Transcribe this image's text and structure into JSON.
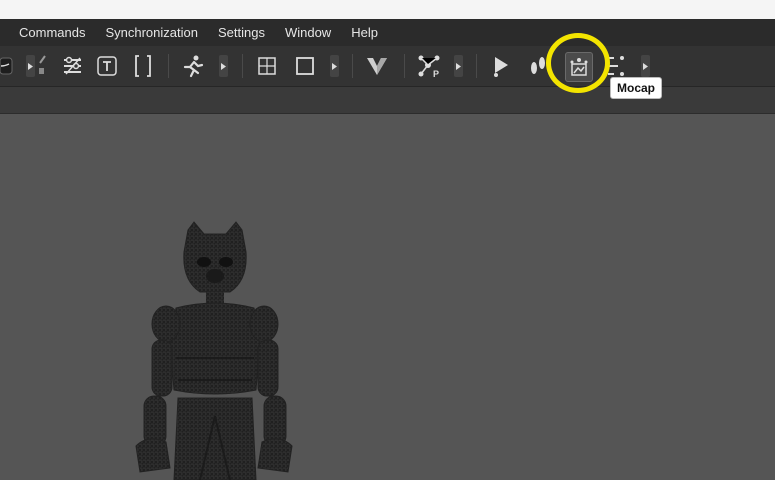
{
  "menubar": {
    "items": [
      "Commands",
      "Synchronization",
      "Settings",
      "Window",
      "Help"
    ]
  },
  "toolbar": {
    "icons": [
      "curve-icon",
      "wire-icon",
      "adjust-icon",
      "text-icon",
      "bracket-icon",
      "run-icon",
      "frame-icon",
      "square-icon",
      "v-logo-icon",
      "physics-icon",
      "cam-icon",
      "footprints-icon",
      "mocap-icon",
      "tracking-icon"
    ],
    "highlighted": "mocap-icon"
  },
  "tooltip": {
    "text": "Mocap"
  },
  "colors": {
    "menubar_bg": "#2b2b2b",
    "toolbar_bg": "#333333",
    "viewport_bg": "#555555",
    "highlight": "#f3e400"
  }
}
